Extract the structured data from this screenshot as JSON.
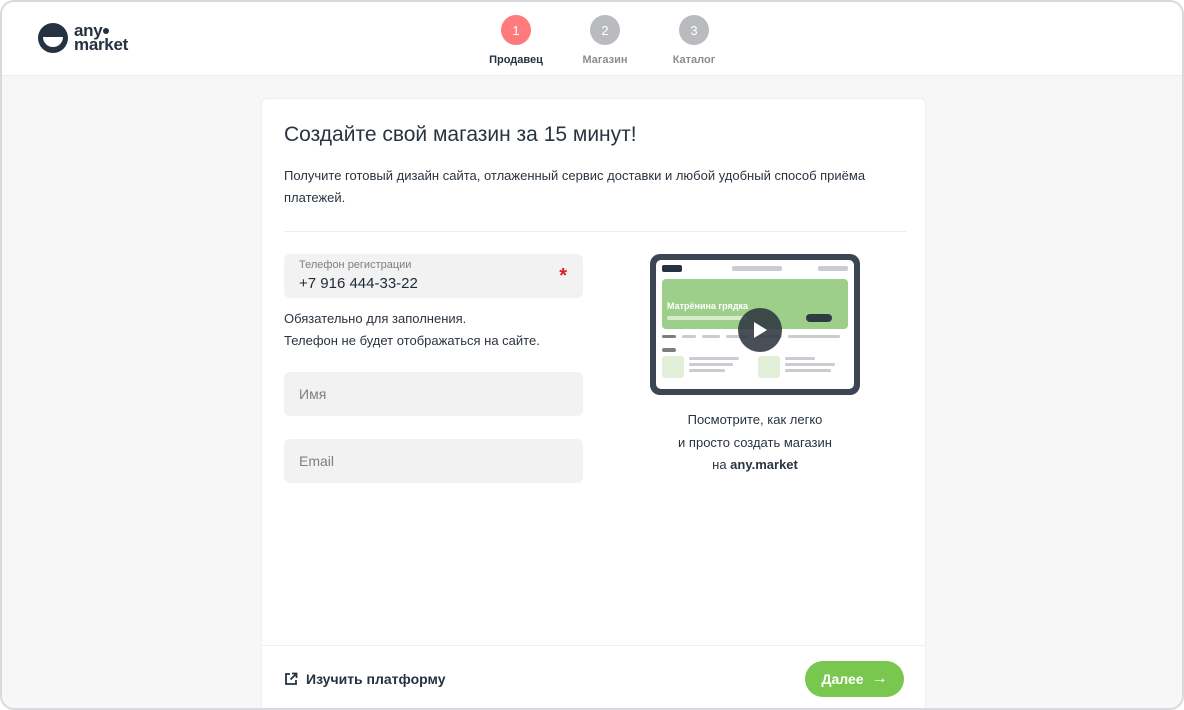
{
  "brand": {
    "line1": "any",
    "line2": "market"
  },
  "steps": [
    {
      "num": "1",
      "label": "Продавец",
      "active": true
    },
    {
      "num": "2",
      "label": "Магазин",
      "active": false
    },
    {
      "num": "3",
      "label": "Каталог",
      "active": false
    }
  ],
  "card": {
    "title": "Создайте свой магазин за 15 минут!",
    "subtitle": "Получите готовый дизайн сайта, отлаженный сервис доставки и любой удобный способ приёма платежей."
  },
  "form": {
    "phone_label": "Телефон регистрации",
    "phone_value": "+7 916 444-33-22",
    "required_mark": "*",
    "hint_line1": "Обязательно для заполнения.",
    "hint_line2": "Телефон не будет отображаться на сайте.",
    "name_placeholder": "Имя",
    "email_placeholder": "Email"
  },
  "preview": {
    "banner_title": "Матрёнина грядка",
    "caption_line1": "Посмотрите, как легко",
    "caption_line2": "и просто создать магазин",
    "caption_prefix": "на ",
    "caption_brand": "any.market"
  },
  "footer": {
    "learn_label": "Изучить платформу",
    "next_label": "Далее",
    "next_arrow": "→"
  },
  "colors": {
    "accent_green": "#7ac74f",
    "step_active": "#ff7a7a",
    "step_inactive": "#b9bbbe",
    "required": "#e11d1d"
  }
}
